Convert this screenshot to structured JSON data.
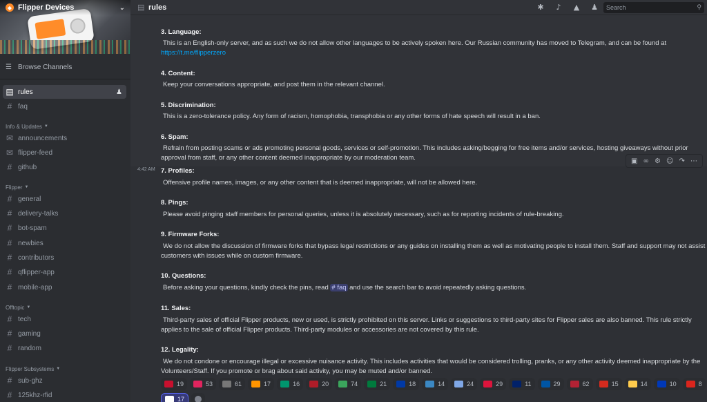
{
  "server": {
    "name": "Flipper Devices"
  },
  "sidebar": {
    "browse_label": "Browse Channels",
    "top_channels": [
      {
        "name": "rules",
        "active": true
      },
      {
        "name": "faq"
      }
    ],
    "categories": [
      {
        "label": "Info & Updates",
        "channels": [
          "announcements",
          "flipper-feed",
          "github"
        ]
      },
      {
        "label": "Flipper",
        "channels": [
          "general",
          "delivery-talks",
          "bot-spam",
          "newbies",
          "contributors",
          "qflipper-app",
          "mobile-app"
        ]
      },
      {
        "label": "Offtopic",
        "channels": [
          "tech",
          "gaming",
          "random"
        ]
      },
      {
        "label": "Flipper Subsystems",
        "channels": [
          "sub-ghz",
          "125khz-rfid"
        ]
      }
    ]
  },
  "topbar": {
    "channel": "rules",
    "search_placeholder": "Search"
  },
  "message": {
    "timestamp": "4:42 AM",
    "rules": [
      {
        "title": "3. Language:",
        "body_pre": "This is an English-only server, and as such we do not allow other languages to be actively spoken here.  Our Russian community has moved to Telegram, and can be found at",
        "link": "https://t.me/flipperzero"
      },
      {
        "title": "4. Content:",
        "body": "Keep your conversations appropriate, and post them in the relevant channel."
      },
      {
        "title": "5. Discrimination:",
        "body": "This is a zero-tolerance policy. Any form of racism, homophobia, transphobia or any other forms of hate speech will result in a ban."
      },
      {
        "title": "6. Spam:",
        "body": "Refrain from posting scams or ads promoting personal goods, services or self-promotion. This includes asking/begging for free items and/or services, hosting giveaways without prior approval from staff, or any other content deemed inappropriate by our moderation team."
      },
      {
        "title": "7. Profiles:",
        "body": "Offensive profile names, images, or any other content that is deemed inappropriate, will not be allowed here."
      },
      {
        "title": "8. Pings:",
        "body": "Please avoid pinging staff members for personal queries, unless it is absolutely necessary, such as for reporting incidents of rule-breaking."
      },
      {
        "title": "9. Firmware Forks:",
        "body": "We do not allow the discussion of firmware forks that bypass legal restrictions or any guides on installing them as well as motivating people to install them. Staff and support may not assist customers with issues while on custom firmware."
      },
      {
        "title": "10. Questions:",
        "body_pre": "Before asking your questions, kindly check the pins, read",
        "mention": "# faq",
        "body_post": "and use the search bar to avoid repeatedly asking questions."
      },
      {
        "title": "11. Sales:",
        "body": "Third-party sales of official Flipper products, new or used, is strictly prohibited on this server. Links or suggestions to third-party sites for Flipper sales are also banned. This rule strictly applies to the sale of official Flipper products. Third-party modules or accessories are not covered by this rule."
      },
      {
        "title": "12. Legality:",
        "body": "We do not condone or encourage illegal or excessive nuisance activity.  This includes activities that would be considered trolling, pranks, or any other activity deemed inappropriate by the Volunteers/Staff.  If you promote or brag about said activity, you may be muted and/or banned."
      }
    ],
    "reactions": [
      {
        "emoji": "flag-croatia",
        "count": "19",
        "color": "#c8102e"
      },
      {
        "emoji": "hundred-points",
        "count": "53",
        "color": "#e0245e"
      },
      {
        "emoji": "read-the-rules",
        "count": "61",
        "color": "#777777"
      },
      {
        "emoji": "firefox-like",
        "count": "17",
        "color": "#ff9500"
      },
      {
        "emoji": "flag-bulgaria",
        "count": "16",
        "color": "#00966e"
      },
      {
        "emoji": "flag-netherlands",
        "count": "20",
        "color": "#ae1c28"
      },
      {
        "emoji": "check-mark",
        "count": "74",
        "color": "#3ba55c"
      },
      {
        "emoji": "flag-palestine",
        "count": "21",
        "color": "#007a3d"
      },
      {
        "emoji": "flag-russia",
        "count": "18",
        "color": "#0039a6"
      },
      {
        "emoji": "dolphin",
        "count": "14",
        "color": "#3b88c3"
      },
      {
        "emoji": "ghost-blue",
        "count": "24",
        "color": "#7fa7e6"
      },
      {
        "emoji": "flag-poland",
        "count": "29",
        "color": "#dc143c"
      },
      {
        "emoji": "flag-australia",
        "count": "11",
        "color": "#012169"
      },
      {
        "emoji": "flag-france",
        "count": "29",
        "color": "#0055a4"
      },
      {
        "emoji": "flag-usa",
        "count": "62",
        "color": "#b22234"
      },
      {
        "emoji": "flag-chile",
        "count": "15",
        "color": "#d52b1e"
      },
      {
        "emoji": "thinking-face",
        "count": "14",
        "color": "#ffcc4d"
      },
      {
        "emoji": "flag-israel",
        "count": "10",
        "color": "#0038b8"
      },
      {
        "emoji": "flag-vietnam",
        "count": "8",
        "color": "#da251d"
      },
      {
        "emoji": "ghost",
        "count": "17",
        "color": "#ffffff",
        "me": true
      },
      {
        "emoji": "add-reaction",
        "count": "",
        "color": "#80848e"
      }
    ]
  }
}
